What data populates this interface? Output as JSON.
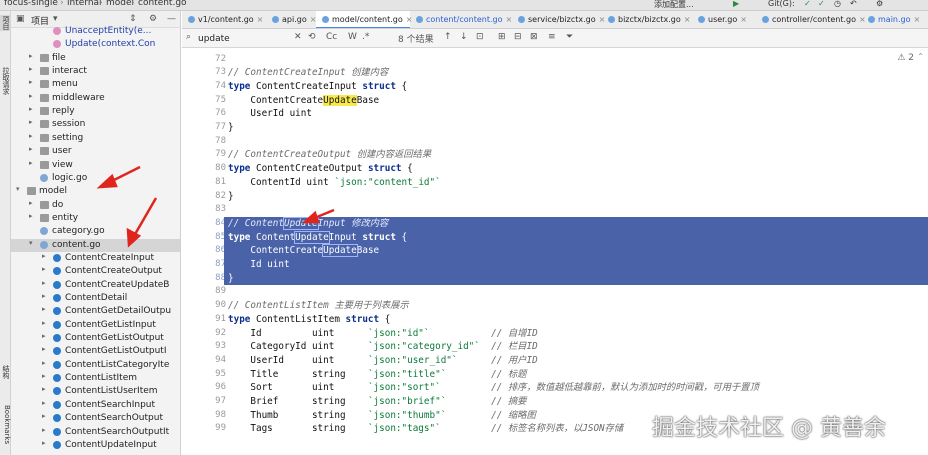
{
  "breadcrumb": {
    "items": [
      "focus-single",
      "internal",
      "model",
      "content.go"
    ]
  },
  "topbar_right": {
    "add_config": "添加配置...",
    "git": "Git(G):"
  },
  "left_strip": {
    "labels": [
      "项目",
      "拉取请求",
      "结构",
      "Bookmarks"
    ]
  },
  "project": {
    "title": "项目",
    "tree": [
      {
        "label": "UnacceptEntity(e...",
        "type": "method",
        "indent": 3
      },
      {
        "label": "Update(context.Con",
        "type": "method",
        "indent": 3
      },
      {
        "label": "file",
        "type": "folder",
        "indent": 2
      },
      {
        "label": "interact",
        "type": "folder",
        "indent": 2
      },
      {
        "label": "menu",
        "type": "folder",
        "indent": 2
      },
      {
        "label": "middleware",
        "type": "folder",
        "indent": 2
      },
      {
        "label": "reply",
        "type": "folder",
        "indent": 2
      },
      {
        "label": "session",
        "type": "folder",
        "indent": 2
      },
      {
        "label": "setting",
        "type": "folder",
        "indent": 2
      },
      {
        "label": "user",
        "type": "folder",
        "indent": 2
      },
      {
        "label": "view",
        "type": "folder",
        "indent": 2
      },
      {
        "label": "logic.go",
        "type": "gofile",
        "indent": 2
      },
      {
        "label": "model",
        "type": "folder",
        "indent": 1,
        "expanded": true
      },
      {
        "label": "do",
        "type": "folder",
        "indent": 2
      },
      {
        "label": "entity",
        "type": "folder",
        "indent": 2
      },
      {
        "label": "category.go",
        "type": "gofile",
        "indent": 2
      },
      {
        "label": "content.go",
        "type": "gofile",
        "indent": 2,
        "expanded": true,
        "selected": true
      },
      {
        "label": "ContentCreateInput",
        "type": "struct",
        "indent": 3
      },
      {
        "label": "ContentCreateOutput",
        "type": "struct",
        "indent": 3
      },
      {
        "label": "ContentCreateUpdateB",
        "type": "struct",
        "indent": 3
      },
      {
        "label": "ContentDetail",
        "type": "struct",
        "indent": 3
      },
      {
        "label": "ContentGetDetailOutpu",
        "type": "struct",
        "indent": 3
      },
      {
        "label": "ContentGetListInput",
        "type": "struct",
        "indent": 3
      },
      {
        "label": "ContentGetListOutput",
        "type": "struct",
        "indent": 3
      },
      {
        "label": "ContentGetListOutputI",
        "type": "struct",
        "indent": 3
      },
      {
        "label": "ContentListCategoryIte",
        "type": "struct",
        "indent": 3
      },
      {
        "label": "ContentListItem",
        "type": "struct",
        "indent": 3
      },
      {
        "label": "ContentListUserItem",
        "type": "struct",
        "indent": 3
      },
      {
        "label": "ContentSearchInput",
        "type": "struct",
        "indent": 3
      },
      {
        "label": "ContentSearchOutput",
        "type": "struct",
        "indent": 3
      },
      {
        "label": "ContentSearchOutputIt",
        "type": "struct",
        "indent": 3
      },
      {
        "label": "ContentUpdateInput",
        "type": "struct",
        "indent": 3
      }
    ]
  },
  "tabs": [
    {
      "label": "v1/content.go"
    },
    {
      "label": "api.go"
    },
    {
      "label": "model/content.go",
      "active": true
    },
    {
      "label": "content/content.go",
      "blue": true
    },
    {
      "label": "service/bizctx.go"
    },
    {
      "label": "bizctx/bizctx.go"
    },
    {
      "label": "user.go"
    },
    {
      "label": "controller/content.go"
    },
    {
      "label": "main.go",
      "blue": true
    }
  ],
  "search": {
    "value": "update",
    "result_count": "8 个结果",
    "case_label": "Cc",
    "word_label": "W"
  },
  "editor": {
    "warning_count": "2",
    "lines": [
      {
        "n": "72",
        "tokens": []
      },
      {
        "n": "73",
        "tokens": [
          {
            "t": "// ContentCreateInput 创建内容",
            "c": "cm"
          }
        ]
      },
      {
        "n": "74",
        "tokens": [
          {
            "t": "type",
            "c": "kw"
          },
          {
            "t": " ContentCreateInput "
          },
          {
            "t": "struct",
            "c": "kw"
          },
          {
            "t": " {"
          }
        ]
      },
      {
        "n": "75",
        "tokens": [
          {
            "t": "    ContentCreate"
          },
          {
            "t": "Update",
            "c": "hl"
          },
          {
            "t": "Base"
          }
        ]
      },
      {
        "n": "76",
        "tokens": [
          {
            "t": "    UserId uint"
          }
        ]
      },
      {
        "n": "77",
        "tokens": [
          {
            "t": "}"
          }
        ]
      },
      {
        "n": "78",
        "tokens": []
      },
      {
        "n": "79",
        "tokens": [
          {
            "t": "// ContentCreateOutput 创建内容返回结果",
            "c": "cm"
          }
        ]
      },
      {
        "n": "80",
        "tokens": [
          {
            "t": "type",
            "c": "kw"
          },
          {
            "t": " ContentCreateOutput "
          },
          {
            "t": "struct",
            "c": "kw"
          },
          {
            "t": " {"
          }
        ]
      },
      {
        "n": "81",
        "tokens": [
          {
            "t": "    ContentId uint "
          },
          {
            "t": "`json:\"content_id\"`",
            "c": "tag"
          }
        ]
      },
      {
        "n": "82",
        "tokens": [
          {
            "t": "}"
          }
        ]
      },
      {
        "n": "83",
        "tokens": []
      },
      {
        "n": "84",
        "sel": true,
        "tokens": [
          {
            "t": "// Content",
            "c": "cm"
          },
          {
            "t": "Update",
            "c": "cm hl-box"
          },
          {
            "t": "Input 修改内容",
            "c": "cm"
          }
        ]
      },
      {
        "n": "85",
        "sel": true,
        "tokens": [
          {
            "t": "type",
            "c": "kw"
          },
          {
            "t": " Content"
          },
          {
            "t": "Update",
            "c": "hl-box"
          },
          {
            "t": "Input "
          },
          {
            "t": "struct",
            "c": "kw"
          },
          {
            "t": " {"
          }
        ]
      },
      {
        "n": "86",
        "sel": true,
        "tokens": [
          {
            "t": "    ContentCreate"
          },
          {
            "t": "Update",
            "c": "hl-box"
          },
          {
            "t": "Base"
          }
        ]
      },
      {
        "n": "87",
        "sel": true,
        "tokens": [
          {
            "t": "    Id uint"
          }
        ]
      },
      {
        "n": "88",
        "sel": true,
        "tokens": [
          {
            "t": "}"
          }
        ]
      },
      {
        "n": "89",
        "tokens": []
      },
      {
        "n": "90",
        "tokens": [
          {
            "t": "// ContentListItem 主要用于列表展示",
            "c": "cm"
          }
        ]
      },
      {
        "n": "91",
        "tokens": [
          {
            "t": "type",
            "c": "kw"
          },
          {
            "t": " ContentListItem "
          },
          {
            "t": "struct",
            "c": "kw"
          },
          {
            "t": " {"
          }
        ]
      },
      {
        "n": "92",
        "tokens": [
          {
            "t": "    Id         uint      "
          },
          {
            "t": "`json:\"id\"`",
            "c": "tag"
          },
          {
            "t": "           "
          },
          {
            "t": "// 自增ID",
            "c": "cm"
          }
        ]
      },
      {
        "n": "93",
        "tokens": [
          {
            "t": "    CategoryId uint      "
          },
          {
            "t": "`json:\"category_id\"`",
            "c": "tag"
          },
          {
            "t": "  "
          },
          {
            "t": "// 栏目ID",
            "c": "cm"
          }
        ]
      },
      {
        "n": "94",
        "tokens": [
          {
            "t": "    UserId     uint      "
          },
          {
            "t": "`json:\"user_id\"`",
            "c": "tag"
          },
          {
            "t": "      "
          },
          {
            "t": "// 用户ID",
            "c": "cm"
          }
        ]
      },
      {
        "n": "95",
        "tokens": [
          {
            "t": "    Title      string    "
          },
          {
            "t": "`json:\"title\"`",
            "c": "tag"
          },
          {
            "t": "        "
          },
          {
            "t": "// 标题",
            "c": "cm"
          }
        ]
      },
      {
        "n": "96",
        "tokens": [
          {
            "t": "    Sort       uint      "
          },
          {
            "t": "`json:\"sort\"`",
            "c": "tag"
          },
          {
            "t": "         "
          },
          {
            "t": "// 排序，数值越低越靠前，默认为添加时的时间戳，可用于置顶",
            "c": "cm"
          }
        ]
      },
      {
        "n": "97",
        "tokens": [
          {
            "t": "    Brief      string    "
          },
          {
            "t": "`json:\"brief\"`",
            "c": "tag"
          },
          {
            "t": "        "
          },
          {
            "t": "// 摘要",
            "c": "cm"
          }
        ]
      },
      {
        "n": "98",
        "tokens": [
          {
            "t": "    Thumb      string    "
          },
          {
            "t": "`json:\"thumb\"`",
            "c": "tag"
          },
          {
            "t": "        "
          },
          {
            "t": "// 缩略图",
            "c": "cm"
          }
        ]
      },
      {
        "n": "99",
        "tokens": [
          {
            "t": "    Tags       string    "
          },
          {
            "t": "`json:\"tags\"`",
            "c": "tag"
          },
          {
            "t": "         "
          },
          {
            "t": "// 标签名称列表，以JSON存储",
            "c": "cm"
          }
        ]
      }
    ]
  },
  "watermark": "掘金技术社区 @ 黄善余"
}
